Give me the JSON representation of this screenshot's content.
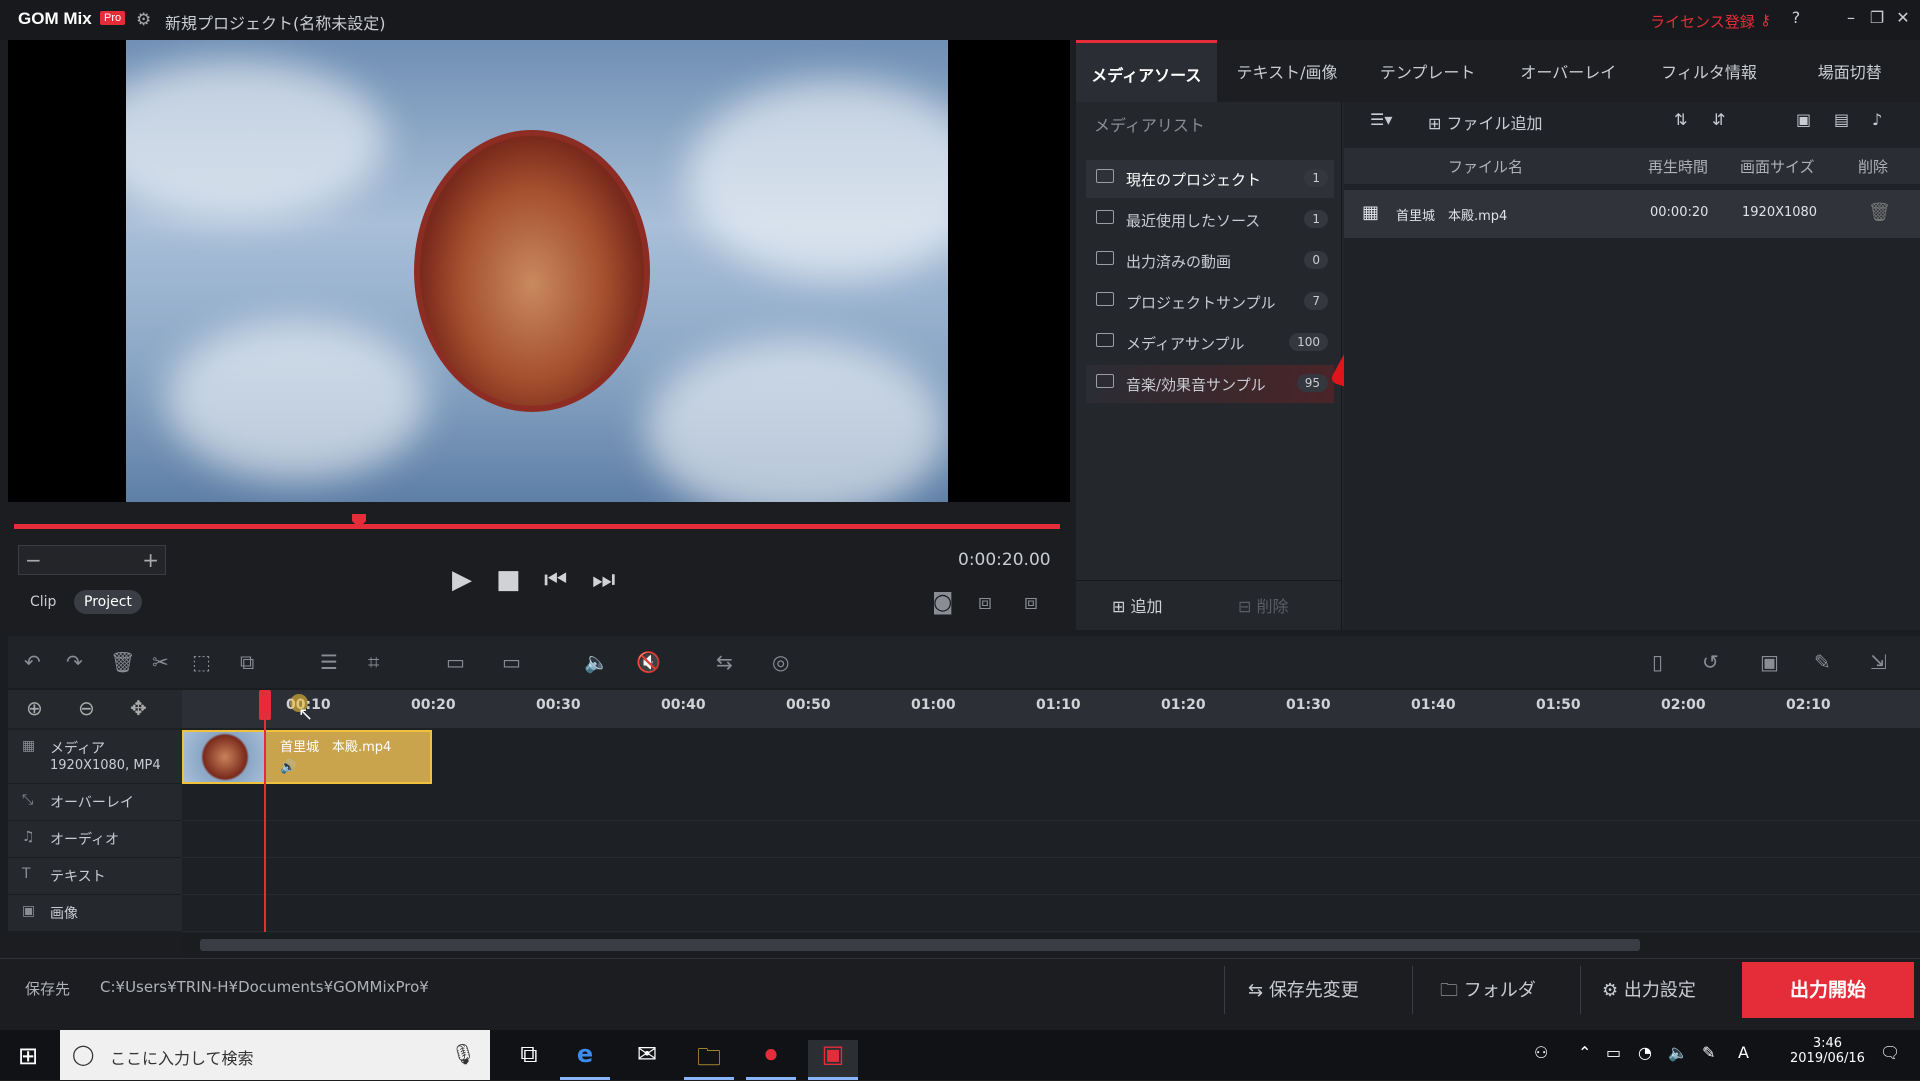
{
  "window": {
    "logo": "GOM Mix",
    "badge": "Pro",
    "title": "新規プロジェクト(名称未設定)",
    "license": "ライセンス登録",
    "help": "?",
    "min": "–",
    "restore": "❐",
    "close": "✕"
  },
  "player": {
    "timecode": "0:00:20.00",
    "modes": [
      "Clip",
      "Project"
    ],
    "active_mode": "Project",
    "progress_fraction": 0.33
  },
  "tabs": [
    "メディアソース",
    "テキスト/画像",
    "テンプレート",
    "オーバーレイ",
    "フィルタ情報",
    "場面切替"
  ],
  "medialist": {
    "heading": "メディアリスト",
    "folders": [
      {
        "label": "現在のプロジェクト",
        "count": "1"
      },
      {
        "label": "最近使用したソース",
        "count": "1"
      },
      {
        "label": "出力済みの動画",
        "count": "0"
      },
      {
        "label": "プロジェクトサンプル",
        "count": "7"
      },
      {
        "label": "メディアサンプル",
        "count": "100"
      },
      {
        "label": "音楽/効果音サンプル",
        "count": "95"
      }
    ],
    "add": "追加",
    "remove": "削除"
  },
  "files": {
    "add_file": "ファイル追加",
    "columns": [
      "ファイル名",
      "再生時間",
      "画面サイズ",
      "削除"
    ],
    "rows": [
      {
        "name": "首里城　本殿.mp4",
        "duration": "00:00:20",
        "size": "1920X1080"
      }
    ]
  },
  "timeline": {
    "ticks": [
      "00:10",
      "00:20",
      "00:30",
      "00:40",
      "00:50",
      "01:00",
      "01:10",
      "01:20",
      "01:30",
      "01:40",
      "01:50",
      "02:00",
      "02:10"
    ],
    "tracks": [
      {
        "name": "メディア",
        "sub": "1920X1080, MP4",
        "icon": "film-icon"
      },
      {
        "name": "オーバーレイ",
        "icon": "overlay-icon"
      },
      {
        "name": "オーディオ",
        "icon": "music-icon"
      },
      {
        "name": "テキスト",
        "icon": "text-icon"
      },
      {
        "name": "画像",
        "icon": "image-icon"
      }
    ],
    "clip_name": "首里城　本殿.mp4"
  },
  "bottom": {
    "save_label": "保存先",
    "save_path": "C:¥Users¥TRIN-H¥Documents¥GOMMixPro¥",
    "change_dest": "保存先変更",
    "folder": "フォルダ",
    "output_settings": "出力設定",
    "export": "出力開始"
  },
  "taskbar": {
    "search_placeholder": "ここに入力して検索",
    "time": "3:46",
    "date": "2019/06/16",
    "ime": "A"
  },
  "colors": {
    "accent": "#e52d3a",
    "clip_border": "#f0c23c"
  }
}
